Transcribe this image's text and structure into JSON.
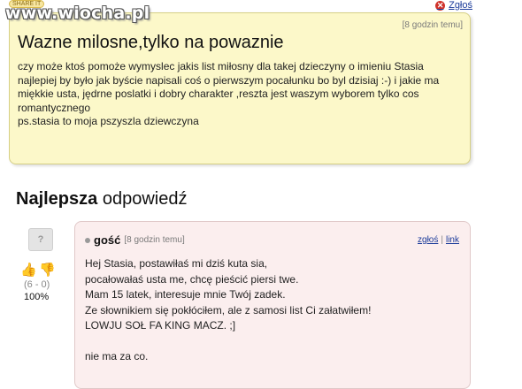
{
  "watermark": "www.wiocha.pl",
  "badge": "SHARE IT",
  "report_top": "Zgłoś",
  "question": {
    "time": "[8 godzin temu]",
    "title": "Wazne milosne,tylko na powaznie",
    "lines": [
      "czy może ktoś pomoże wymyslec jakis list miłosny dla takej dzieczyny o imieniu Stasia",
      "najlepiej by było jak byście napisali coś o pierwszym pocałunku bo byl dzisiaj :-) i jakie ma miękkie usta, jędrne poslatki i dobry charakter ,reszta jest waszym wyborem tylko cos romantycznego",
      "ps.stasia to moja pszyszla dziewczyna"
    ]
  },
  "best": {
    "bold": "Najlepsza",
    "rest": " odpowiedź"
  },
  "vote": {
    "score": "(6 - 0)",
    "percent": "100%"
  },
  "answer": {
    "user": "gość",
    "time": "[8 godzin temu]",
    "report": "zgłoś",
    "link": "link",
    "lines": [
      "Hej Stasia, postawiłaś mi dziś kuta sia,",
      "pocałowałaś usta me, chcę pieścić piersi twe.",
      "Mam 15 latek, interesuje mnie Twój zadek.",
      "Ze słownikiem się pokłóciłem, ale z samosi list Ci załatwiłem!",
      "LOWJU SOŁ FA KING MACZ. ;]",
      "",
      "nie ma za co."
    ]
  }
}
